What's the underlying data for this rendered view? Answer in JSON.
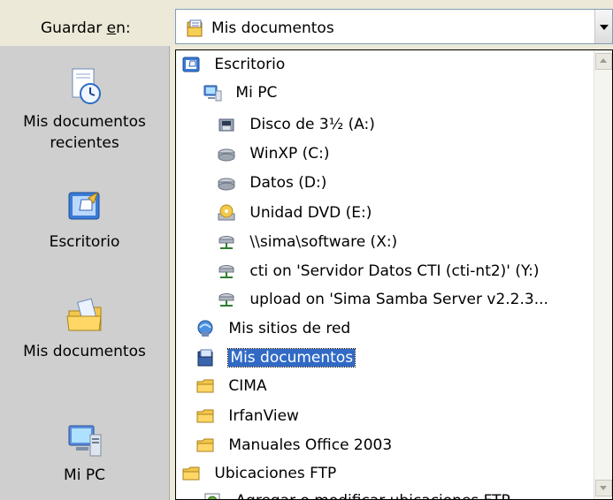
{
  "top": {
    "label_before": "Guardar ",
    "label_u": "e",
    "label_after": "n:",
    "combo_value": "Mis documentos"
  },
  "places": [
    {
      "label_l1": "Mis documentos",
      "label_l2": "recientes",
      "icon": "recent-documents-icon"
    },
    {
      "label_l1": "Escritorio",
      "label_l2": "",
      "icon": "desktop-icon"
    },
    {
      "label_l1": "Mis documentos",
      "label_l2": "",
      "icon": "my-documents-folder-icon"
    },
    {
      "label_l1": "Mi PC",
      "label_l2": "",
      "icon": "my-computer-icon"
    }
  ],
  "list": {
    "items": [
      {
        "label": "Escritorio",
        "icon": "desktop-icon"
      },
      {
        "label": "Mi PC",
        "icon": "my-computer-icon"
      },
      {
        "label": "Disco de 3½ (A:)",
        "icon": "floppy-drive-icon"
      },
      {
        "label": "WinXP (C:)",
        "icon": "hard-drive-icon"
      },
      {
        "label": "Datos (D:)",
        "icon": "hard-drive-icon"
      },
      {
        "label": "Unidad DVD (E:)",
        "icon": "dvd-drive-icon"
      },
      {
        "label": "\\\\sima\\software (X:)",
        "icon": "network-drive-icon"
      },
      {
        "label": "cti on 'Servidor Datos CTI (cti-nt2)' (Y:)",
        "icon": "network-drive-icon"
      },
      {
        "label": "upload on 'Sima Samba Server v2.2.3...",
        "icon": "network-drive-icon"
      },
      {
        "label": "Mis sitios de red",
        "icon": "network-places-icon"
      },
      {
        "label": "Mis documentos",
        "icon": "my-documents-icon"
      },
      {
        "label": "CIMA",
        "icon": "folder-icon"
      },
      {
        "label": "IrfanView",
        "icon": "folder-icon"
      },
      {
        "label": "Manuales Office 2003",
        "icon": "folder-icon"
      },
      {
        "label": "Ubicaciones FTP",
        "icon": "folder-icon"
      },
      {
        "label": "Agregar o modificar ubicaciones FTP",
        "icon": "ftp-add-icon"
      }
    ],
    "selected_label": "Mis documentos"
  },
  "colors": {
    "selection": "#316ac5",
    "places_bg": "#cfcfcf",
    "window_bg": "#ece9d8"
  }
}
